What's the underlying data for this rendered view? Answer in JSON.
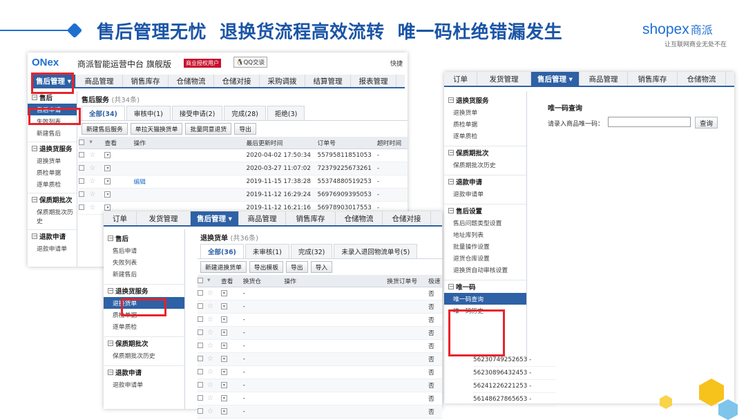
{
  "headline": "售后管理无忧  退换货流程高效流转  唯一码杜绝错漏发生",
  "brand": {
    "logo_name": "shopex",
    "logo_cn": "商派",
    "slogan": "让互联网商业无处不在",
    "accent": "#1f6fd0",
    "orange": "#f28c1a"
  },
  "colors": {
    "nav_blue": "#2e61a5",
    "highlight_red": "#e8232b",
    "title_blue": "#1b55a6"
  },
  "app": {
    "logo": "ONex",
    "title": "商派智能运营中台 旗舰版",
    "license": "商业授权用户",
    "qq": "QQ交谈",
    "quick": "快捷"
  },
  "s1": {
    "tabs": [
      "售后管理 ▾",
      "商品管理",
      "销售库存",
      "仓储物流",
      "仓储对接",
      "采购调拨",
      "结算管理",
      "报表管理"
    ],
    "sidebar": [
      {
        "group": "售后",
        "items": [
          "售后申请",
          "失败列表",
          "新建售后"
        ]
      },
      {
        "group": "退换货服务",
        "items": [
          "退换货单",
          "质检单据",
          "逐单质检"
        ]
      },
      {
        "group": "保质期批次",
        "items": [
          "保质期批次历史"
        ]
      },
      {
        "group": "退款申请",
        "items": [
          "退款申请单"
        ]
      }
    ],
    "heading": "售后服务",
    "count": "(共34条)",
    "filters": [
      "全部(34)",
      "审核中(1)",
      "接受申请(2)",
      "完成(28)",
      "拒绝(3)"
    ],
    "buttons": [
      "新建售后服务",
      "单拉天猫换货单",
      "批量同意退货",
      "导出"
    ],
    "cols": [
      "查看",
      "操作",
      "最后更新时间",
      "订单号",
      "超时时间"
    ],
    "rows": [
      {
        "op": "",
        "time": "2020-04-02 17:50:34",
        "order": "55795811851053",
        "to": "-"
      },
      {
        "op": "",
        "time": "2020-03-27 11:07:02",
        "order": "72379225673261",
        "to": "-"
      },
      {
        "op": "编辑",
        "time": "2019-11-15 17:38:28",
        "order": "55374880519253",
        "to": "-"
      },
      {
        "op": "",
        "time": "2019-11-12 16:29:24",
        "order": "56976909395053",
        "to": "-"
      },
      {
        "op": "",
        "time": "2019-11-12 16:21:16",
        "order": "56978903017553",
        "to": "-"
      }
    ]
  },
  "s2": {
    "tabs": [
      "订单",
      "发货管理",
      "售后管理 ▾",
      "商品管理",
      "销售库存",
      "仓储物流",
      "仓储对接"
    ],
    "sidebar": [
      {
        "group": "售后",
        "items": [
          "售后申请",
          "失败列表",
          "新建售后"
        ]
      },
      {
        "group": "退换货服务",
        "items": [
          "退换货单",
          "质检单据",
          "逐单质检"
        ]
      },
      {
        "group": "保质期批次",
        "items": [
          "保质期批次历史"
        ]
      },
      {
        "group": "退款申请",
        "items": [
          "退款申请单"
        ]
      }
    ],
    "heading": "退换货单",
    "count": "(共36条)",
    "filters": [
      "全部(36)",
      "未审核(1)",
      "完成(32)",
      "未录入退回物流单号(5)"
    ],
    "buttons": [
      "新建退换货单",
      "导出模板",
      "导出",
      "导入"
    ],
    "cols": [
      "查看",
      "换货仓",
      "操作",
      "换货订单号",
      "极速"
    ],
    "rows": [
      "-",
      "-",
      "-",
      "-",
      "-",
      "-",
      "-",
      "-",
      "-",
      "-"
    ],
    "flag": "否"
  },
  "s3": {
    "tabs": [
      "订单",
      "发货管理",
      "售后管理 ▾",
      "商品管理",
      "销售库存",
      "仓储物流"
    ],
    "sidebar": [
      {
        "group": "退换货服务",
        "items": [
          "退换货单",
          "质检单据",
          "逐单质检"
        ]
      },
      {
        "group": "保质期批次",
        "items": [
          "保质期批次历史"
        ]
      },
      {
        "group": "退款申请",
        "items": [
          "退款申请单"
        ]
      },
      {
        "group": "售后设置",
        "items": [
          "售后问题类型设置",
          "地址库列表",
          "批量操作设置",
          "退货仓库设置",
          "退换货自动审核设置"
        ]
      },
      {
        "group": "唯一码",
        "items": [
          "唯一码查询",
          "唯一码历史"
        ]
      }
    ],
    "query_title": "唯一码查询",
    "query_label": "请录入商品唯一码：",
    "query_btn": "查询",
    "numbers": [
      "56230749252653 -",
      "56230896432453 -",
      "56241226221253 -",
      "56148627865653 -"
    ]
  }
}
